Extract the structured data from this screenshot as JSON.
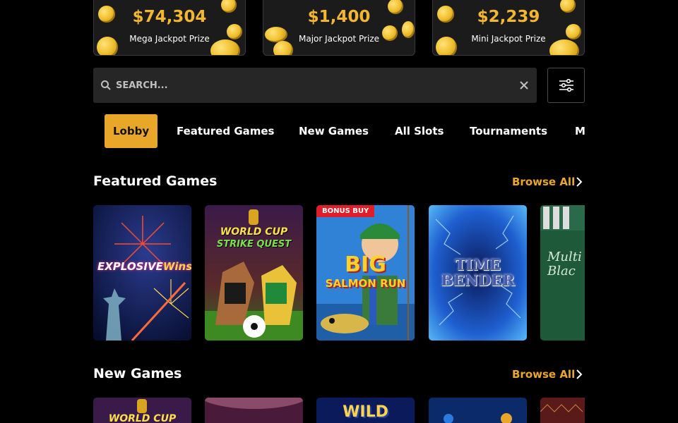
{
  "jackpots": [
    {
      "amount": "$74,304",
      "label": "Mega Jackpot Prize"
    },
    {
      "amount": "$1,400",
      "label": "Major Jackpot Prize"
    },
    {
      "amount": "$2,239",
      "label": "Mini Jackpot Prize"
    }
  ],
  "search": {
    "placeholder": "SEARCH..."
  },
  "tabs": [
    "Lobby",
    "Featured Games",
    "New Games",
    "All Slots",
    "Tournaments",
    "M"
  ],
  "sections": {
    "featured": {
      "title": "Featured Games",
      "browse": "Browse All",
      "games": [
        {
          "title_parts": [
            "EXPLOSIVE",
            "Wins"
          ]
        },
        {
          "title_parts": [
            "WORLD CUP",
            "STRIKE QUEST"
          ]
        },
        {
          "badge": "BONUS BUY",
          "title_parts": [
            "BIG",
            "SALMON RUN"
          ]
        },
        {
          "title_parts": [
            "TIME",
            "BENDER"
          ]
        },
        {
          "title_parts": [
            "Multi",
            "Blac"
          ]
        }
      ]
    },
    "new": {
      "title": "New Games",
      "browse": "Browse All",
      "games": [
        {
          "title_parts": [
            "WORLD CUP"
          ]
        },
        {},
        {
          "title_parts": [
            "WILD"
          ]
        },
        {},
        {}
      ]
    }
  },
  "colors": {
    "accent": "#e9a72a",
    "gold": "#f2b631",
    "search_bg": "#262626"
  }
}
